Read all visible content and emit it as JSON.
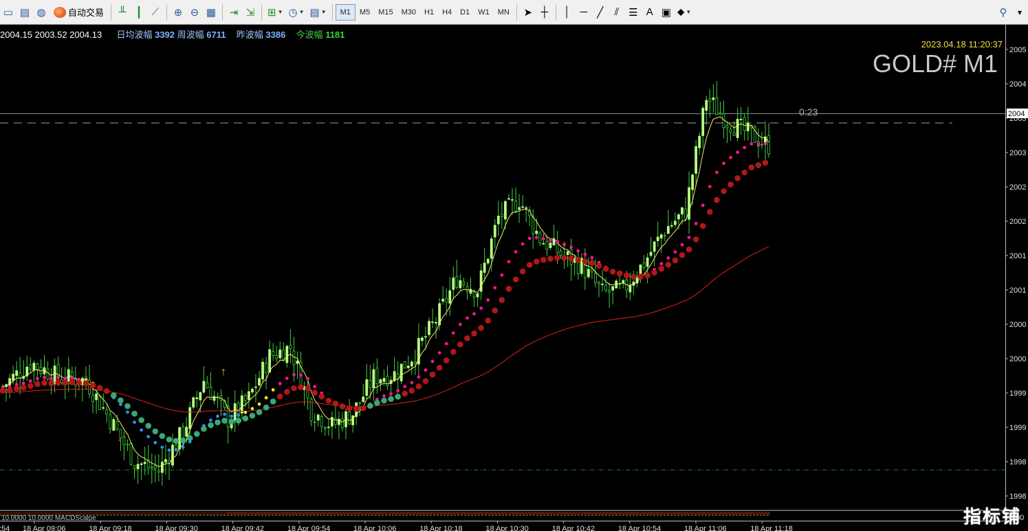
{
  "toolbar": {
    "auto_trade_label": "自动交易",
    "timeframes": [
      "M1",
      "M5",
      "M15",
      "M30",
      "H1",
      "H4",
      "D1",
      "W1",
      "MN"
    ],
    "active_timeframe": "M1"
  },
  "chart": {
    "ohlc_text": "2004.15 2003.52 2004.13",
    "stats": {
      "daily_avg_label": "日均波幅",
      "daily_avg_value": "3392",
      "weekly_label": "周波幅",
      "weekly_value": "6711",
      "yesterday_label": "昨波幅",
      "yesterday_value": "3386",
      "today_label": "今波幅",
      "today_value": "1181"
    },
    "datetime": "2023.04.18 11:20:37",
    "symbol": "GOLD# M1",
    "countdown": "0:23",
    "price_marker": "2004",
    "price_axis": [
      "2005",
      "2004",
      "2003",
      "2003",
      "2002",
      "2002",
      "2001",
      "2001",
      "2000",
      "2000",
      "1999",
      "1999",
      "1998",
      "1998"
    ],
    "time_axis": [
      "18 Apr 09:06",
      "18 Apr 09:18",
      "18 Apr 09:30",
      "18 Apr 09:42",
      "18 Apr 09:54",
      "18 Apr 10:06",
      "18 Apr 10:18",
      "18 Apr 10:30",
      "18 Apr 10:42",
      "18 Apr 10:54",
      "18 Apr 11:06",
      "18 Apr 11:18"
    ],
    "time_axis_left_stub": ":54",
    "subwindow_label": "10.0000 10.0000 MACDScalpe",
    "subwindow_axis": "0.00",
    "colors": {
      "bull": "#b8ff80",
      "bear": "#1a8a1a",
      "wick": "#3fd23f",
      "fast_ma": "#f0f070",
      "slow_ma": "#e02020",
      "dots_magenta": "#ff1493",
      "dots_darkred": "#b01818",
      "dots_teal": "#3aa878",
      "dots_blue": "#2f8ef0",
      "dots_yellow": "#ffe020"
    }
  },
  "chart_data": {
    "type": "candlestick",
    "symbol": "GOLD#",
    "timeframe": "M1",
    "last_quote": {
      "open": 2004.15,
      "low": 2003.52,
      "close": 2004.13
    },
    "x_range": [
      "18 Apr 08:54",
      "18 Apr 11:20"
    ],
    "y_range": [
      1998.0,
      2005.5
    ],
    "y_ticks": [
      2005,
      2004,
      2003,
      2003,
      2002,
      2002,
      2001,
      2001,
      2000,
      2000,
      1999,
      1999,
      1998,
      1998
    ],
    "x_ticks": [
      "18 Apr 09:06",
      "18 Apr 09:18",
      "18 Apr 09:30",
      "18 Apr 09:42",
      "18 Apr 09:54",
      "18 Apr 10:06",
      "18 Apr 10:18",
      "18 Apr 10:30",
      "18 Apr 10:42",
      "18 Apr 10:54",
      "18 Apr 11:06",
      "18 Apr 11:18"
    ],
    "indicators": [
      "MACDScalpe 10.0000 10.0000"
    ]
  },
  "watermark": "指标铺"
}
